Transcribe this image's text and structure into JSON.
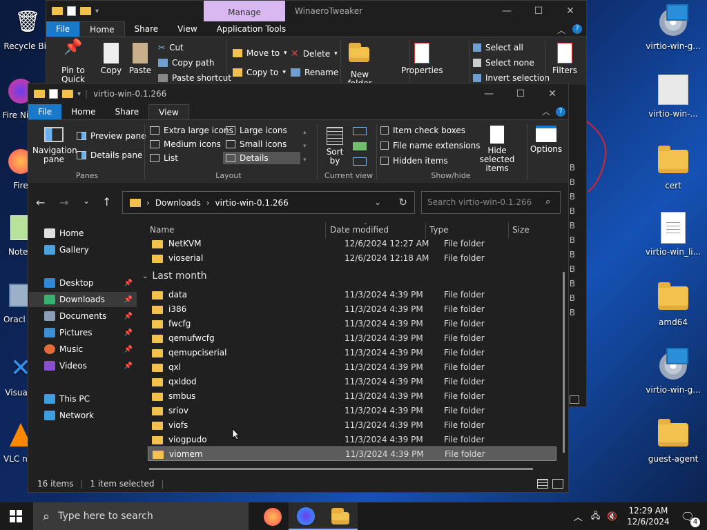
{
  "desktop": {
    "left_icons": [
      "Recycle Bin",
      "Fire Nigh",
      "Fire",
      "Notep",
      "Oracl Virtu",
      "Visual Co",
      "VLC n play"
    ],
    "right_icons": [
      "virtio-win-g...",
      "virtio-win-...",
      "cert",
      "virtio-win_li...",
      "amd64",
      "virtio-win-g...",
      "guest-agent"
    ]
  },
  "back_window": {
    "title": "WinaeroTweaker",
    "contextual_tab": "Manage",
    "tabs": [
      "File",
      "Home",
      "Share",
      "View",
      "Application Tools"
    ],
    "clipboard": {
      "pin": "Pin to Quick access",
      "copy": "Copy",
      "paste": "Paste",
      "cut": "Cut",
      "copy_path": "Copy path",
      "paste_shortcut": "Paste shortcut"
    },
    "organize": {
      "move_to": "Move to",
      "delete": "Delete",
      "copy_to": "Copy to",
      "rename": "Rename"
    },
    "new_folder": "New folder",
    "properties": "Properties",
    "select": {
      "all": "Select all",
      "none": "Select none",
      "invert": "Invert selection"
    },
    "filters": "Filters"
  },
  "front_window": {
    "title": "virtio-win-0.1.266",
    "tabs": {
      "file": "File",
      "home": "Home",
      "share": "Share",
      "view": "View"
    },
    "panes": {
      "navigation": "Navigation pane",
      "preview": "Preview pane",
      "details": "Details pane",
      "label": "Panes"
    },
    "layout": {
      "extra_large": "Extra large icons",
      "large": "Large icons",
      "medium": "Medium icons",
      "small": "Small icons",
      "list": "List",
      "details": "Details",
      "label": "Layout"
    },
    "current_view": {
      "sort": "Sort by",
      "label": "Current view"
    },
    "show_hide": {
      "item_check": "Item check boxes",
      "extensions": "File name extensions",
      "hidden": "Hidden items",
      "hide_selected": "Hide selected items",
      "label": "Show/hide"
    },
    "options": "Options",
    "address": {
      "root": "Downloads",
      "current": "virtio-win-0.1.266"
    },
    "search_placeholder": "Search virtio-win-0.1.266",
    "nav_items": [
      {
        "label": "Home"
      },
      {
        "label": "Gallery"
      },
      {
        "label": "Desktop"
      },
      {
        "label": "Downloads"
      },
      {
        "label": "Documents"
      },
      {
        "label": "Pictures"
      },
      {
        "label": "Music"
      },
      {
        "label": "Videos"
      },
      {
        "label": "This PC"
      },
      {
        "label": "Network"
      }
    ],
    "columns": {
      "name": "Name",
      "date": "Date modified",
      "type": "Type",
      "size": "Size"
    },
    "group_header": "Last month",
    "rows_top": [
      {
        "name": "NetKVM",
        "date": "12/6/2024 12:27 AM",
        "type": "File folder"
      },
      {
        "name": "vioserial",
        "date": "12/6/2024 12:18 AM",
        "type": "File folder"
      }
    ],
    "rows": [
      {
        "name": "data",
        "date": "11/3/2024 4:39 PM",
        "type": "File folder"
      },
      {
        "name": "i386",
        "date": "11/3/2024 4:39 PM",
        "type": "File folder"
      },
      {
        "name": "fwcfg",
        "date": "11/3/2024 4:39 PM",
        "type": "File folder"
      },
      {
        "name": "qemufwcfg",
        "date": "11/3/2024 4:39 PM",
        "type": "File folder"
      },
      {
        "name": "qemupciserial",
        "date": "11/3/2024 4:39 PM",
        "type": "File folder"
      },
      {
        "name": "qxl",
        "date": "11/3/2024 4:39 PM",
        "type": "File folder"
      },
      {
        "name": "qxldod",
        "date": "11/3/2024 4:39 PM",
        "type": "File folder"
      },
      {
        "name": "smbus",
        "date": "11/3/2024 4:39 PM",
        "type": "File folder"
      },
      {
        "name": "sriov",
        "date": "11/3/2024 4:39 PM",
        "type": "File folder"
      },
      {
        "name": "viofs",
        "date": "11/3/2024 4:39 PM",
        "type": "File folder"
      },
      {
        "name": "viogpudo",
        "date": "11/3/2024 4:39 PM",
        "type": "File folder"
      },
      {
        "name": "viomem",
        "date": "11/3/2024 4:39 PM",
        "type": "File folder"
      }
    ],
    "status": {
      "count": "16 items",
      "selected": "1 item selected"
    }
  },
  "taskbar": {
    "search_placeholder": "Type here to search",
    "time": "12:29 AM",
    "date": "12/6/2024",
    "notifications": "4"
  },
  "colors": {
    "accent": "#1979ca",
    "folder": "#f2c14e",
    "manage_tab": "#d9b8f2"
  }
}
